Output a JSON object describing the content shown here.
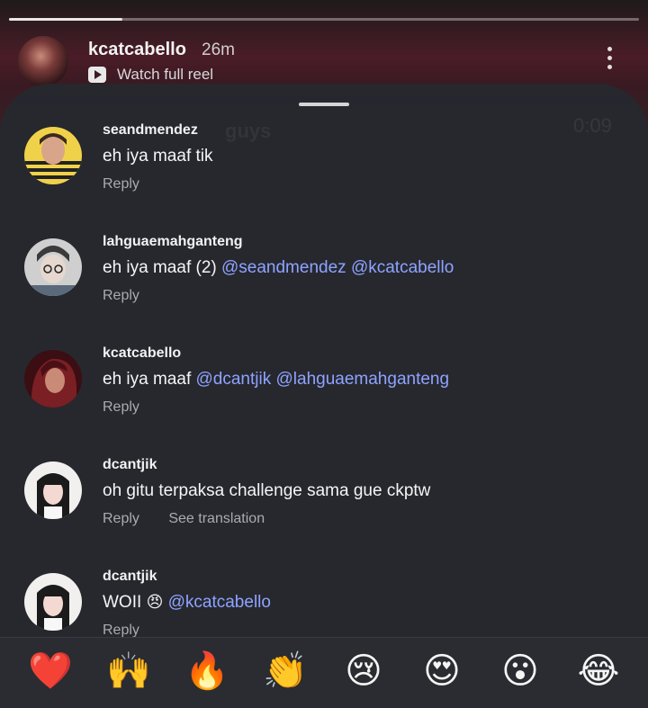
{
  "story": {
    "progress": 0.18,
    "username": "kcatcabello",
    "time": "26m",
    "reel_label": "Watch full reel",
    "ghost_caption": "guys",
    "ghost_time": "0:09"
  },
  "comments": [
    {
      "user": "seandmendez",
      "text": "eh iya maaf tik",
      "mentions": [],
      "actions": [
        "Reply"
      ]
    },
    {
      "user": "lahguaemahganteng",
      "text": "eh iya maaf (2) ",
      "mentions": [
        "@seandmendez",
        "@kcatcabello"
      ],
      "actions": [
        "Reply"
      ]
    },
    {
      "user": "kcatcabello",
      "text": "eh iya maaf ",
      "mentions": [
        "@dcantjik",
        "@lahguaemahganteng"
      ],
      "actions": [
        "Reply"
      ]
    },
    {
      "user": "dcantjik",
      "text": "oh gitu terpaksa challenge sama gue ckptw",
      "mentions": [],
      "actions": [
        "Reply",
        "See translation"
      ]
    },
    {
      "user": "dcantjik",
      "text": "WOII ",
      "emoji": "😠",
      "mentions": [
        "@kcatcabello"
      ],
      "actions": [
        "Reply"
      ]
    }
  ],
  "reactions": [
    "❤️",
    "🙌",
    "🔥",
    "👏",
    "😢",
    "😍",
    "😮",
    "😂"
  ]
}
